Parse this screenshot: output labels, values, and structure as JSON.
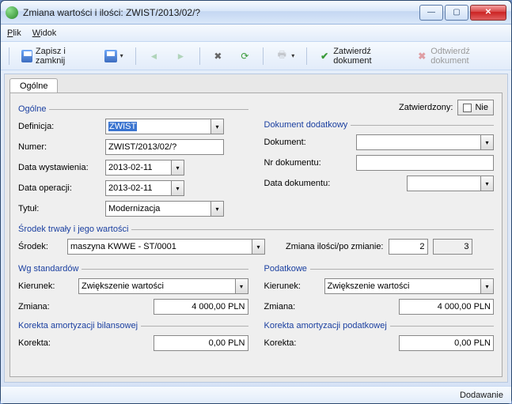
{
  "window": {
    "title": "Zmiana wartości i ilości: ZWIST/2013/02/?"
  },
  "menu": {
    "plik": "Plik",
    "widok": "Widok"
  },
  "toolbar": {
    "save_close": "Zapisz i zamknij",
    "zatwierdz": "Zatwierdź dokument",
    "odtwierdz": "Odtwierdź dokument"
  },
  "tabs": {
    "ogolne": "Ogólne"
  },
  "groups": {
    "ogolne": "Ogólne",
    "zatwierdzony": "Zatwierdzony:",
    "zatw_value": "Nie",
    "definicja_lbl": "Definicja:",
    "definicja_val": "ZWIST",
    "numer_lbl": "Numer:",
    "numer_val": "ZWIST/2013/02/?",
    "data_wyst_lbl": "Data wystawienia:",
    "data_wyst_val": "2013-02-11",
    "data_oper_lbl": "Data operacji:",
    "data_oper_val": "2013-02-11",
    "tytul_lbl": "Tytuł:",
    "tytul_val": "Modernizacja",
    "dok_dodatkowy": "Dokument dodatkowy",
    "dokument_lbl": "Dokument:",
    "dokument_val": "",
    "nr_dokumentu_lbl": "Nr dokumentu:",
    "nr_dokumentu_val": "",
    "data_dokumentu_lbl": "Data dokumentu:",
    "data_dokumentu_val": "",
    "srodek_group": "Środek trwały i jego wartości",
    "srodek_lbl": "Środek:",
    "srodek_val": "maszyna KWWE - ŚT/0001",
    "zmiana_ilosci_lbl": "Zmiana ilości/po zmianie:",
    "zmiana_ilosci_v1": "2",
    "zmiana_ilosci_v2": "3",
    "wg_stand": "Wg standardów",
    "podatkowe": "Podatkowe",
    "kierunek_lbl": "Kierunek:",
    "kierunek_val": "Zwiększenie wartości",
    "zmiana_lbl": "Zmiana:",
    "zmiana_val": "4 000,00 PLN",
    "kor_bil": "Korekta amortyzacji bilansowej",
    "kor_pod": "Korekta amortyzacji podatkowej",
    "korekta_lbl": "Korekta:",
    "korekta_val": "0,00 PLN"
  },
  "status": {
    "text": "Dodawanie"
  }
}
